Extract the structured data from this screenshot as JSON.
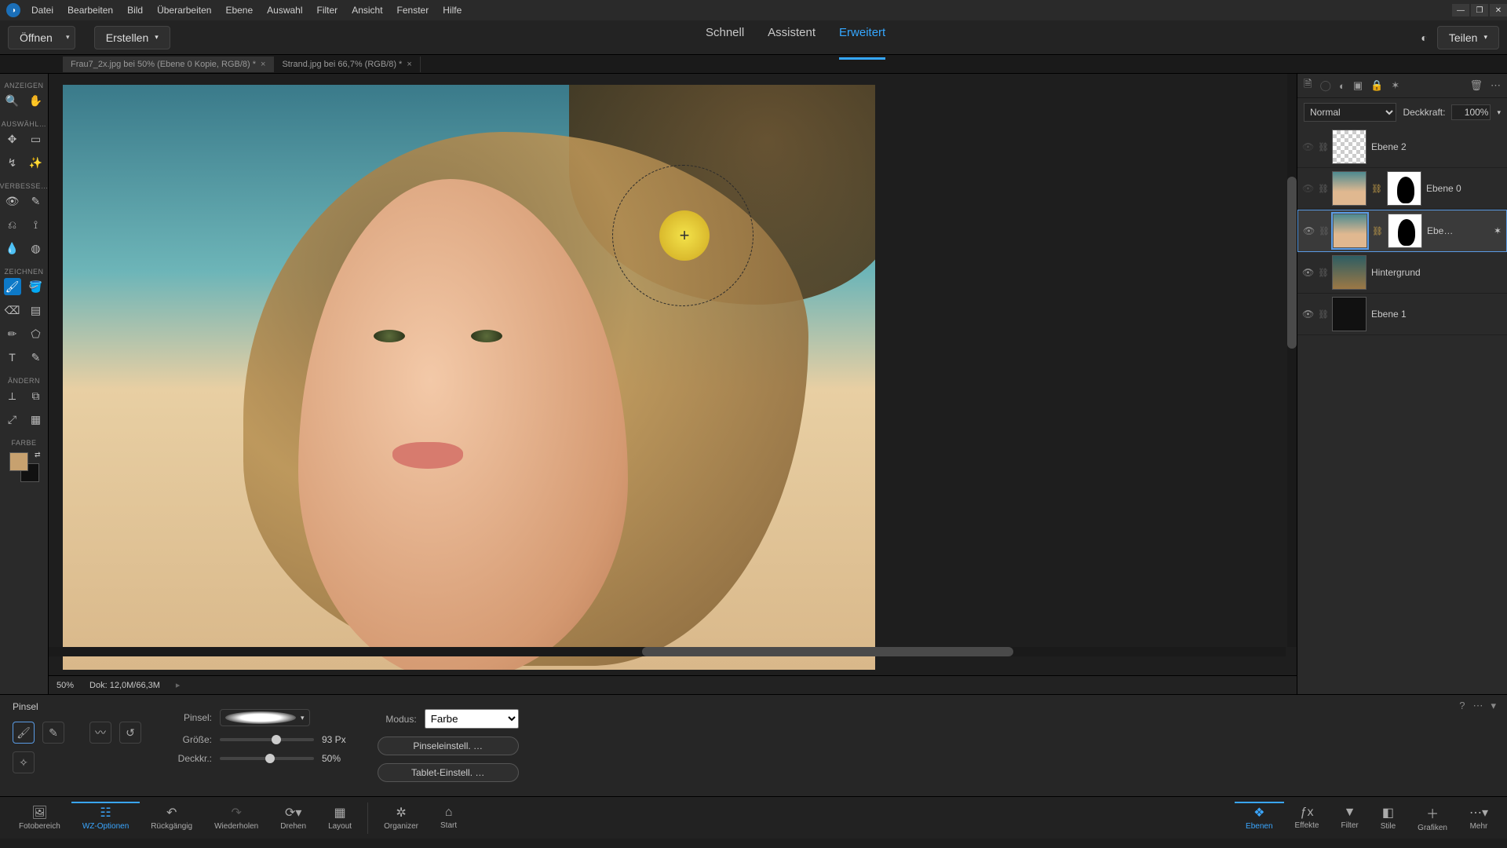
{
  "menu": {
    "items": [
      "Datei",
      "Bearbeiten",
      "Bild",
      "Überarbeiten",
      "Ebene",
      "Auswahl",
      "Filter",
      "Ansicht",
      "Fenster",
      "Hilfe"
    ]
  },
  "secondary": {
    "open_label": "Öffnen",
    "create_label": "Erstellen",
    "share_label": "Teilen",
    "modes": {
      "quick": "Schnell",
      "assistant": "Assistent",
      "advanced": "Erweitert"
    }
  },
  "tabs": {
    "items": [
      {
        "label": "Frau7_2x.jpg bei 50% (Ebene 0 Kopie, RGB/8) *"
      },
      {
        "label": "Strand.jpg bei 66,7% (RGB/8) *"
      }
    ]
  },
  "tools": {
    "groups": {
      "view": "ANZEIGEN",
      "select": "AUSWÄHL…",
      "enhance": "VERBESSE…",
      "draw": "ZEICHNEN",
      "modify": "ÄNDERN",
      "color": "FARBE"
    }
  },
  "status": {
    "zoom": "50%",
    "doc": "Dok: 12,0M/66,3M"
  },
  "layers_panel": {
    "blend_mode_label": "Normal",
    "opacity_label": "Deckkraft:",
    "opacity_value": "100%",
    "items": [
      {
        "name": "Ebene 2",
        "visible": false
      },
      {
        "name": "Ebene 0",
        "visible": false
      },
      {
        "name": "Ebe…",
        "visible": true,
        "selected": true
      },
      {
        "name": "Hintergrund",
        "visible": true
      },
      {
        "name": "Ebene 1",
        "visible": true
      }
    ]
  },
  "options": {
    "tool_name": "Pinsel",
    "brush_label": "Pinsel:",
    "size_label": "Größe:",
    "size_value": "93 Px",
    "opacity_label": "Deckkr.:",
    "opacity_value": "50%",
    "mode_label": "Modus:",
    "mode_value": "Farbe",
    "brush_settings": "Pinseleinstell. …",
    "tablet_settings": "Tablet-Einstell. …"
  },
  "bottombar": {
    "left": [
      {
        "label": "Fotobereich"
      },
      {
        "label": "WZ-Optionen",
        "active": true
      },
      {
        "label": "Rückgängig"
      },
      {
        "label": "Wiederholen"
      },
      {
        "label": "Drehen"
      },
      {
        "label": "Layout"
      }
    ],
    "mid": [
      {
        "label": "Organizer"
      },
      {
        "label": "Start"
      }
    ],
    "right": [
      {
        "label": "Ebenen",
        "active": true
      },
      {
        "label": "Effekte"
      },
      {
        "label": "Filter"
      },
      {
        "label": "Stile"
      },
      {
        "label": "Grafiken"
      },
      {
        "label": "Mehr"
      }
    ]
  },
  "colors": {
    "accent": "#35a7ff"
  }
}
